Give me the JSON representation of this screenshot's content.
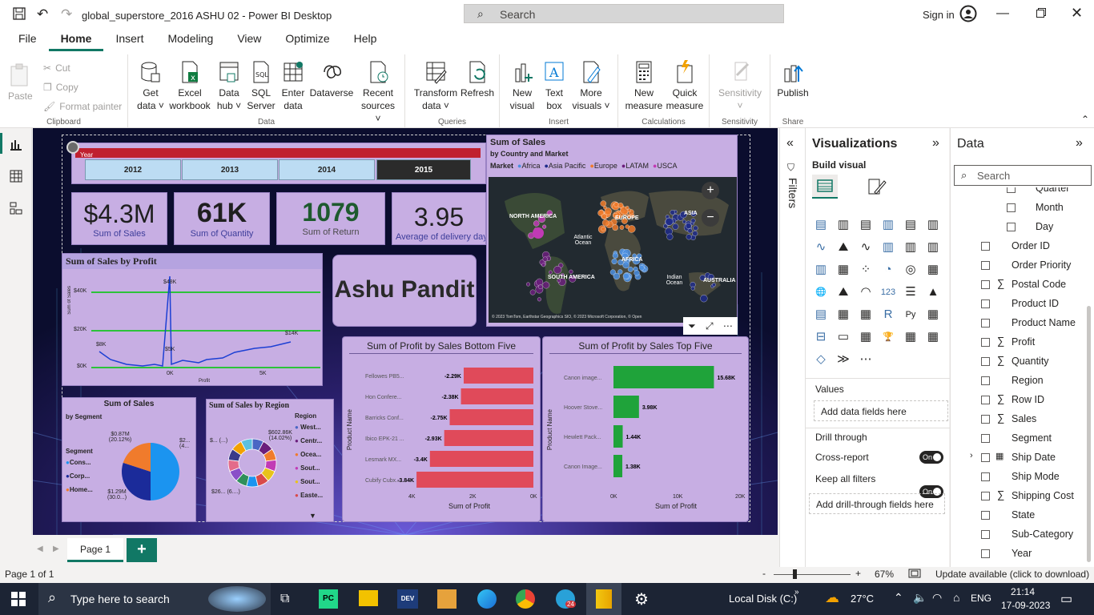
{
  "titlebar": {
    "file": "global_superstore_2016 ASHU 02 - Power BI Desktop",
    "search_placeholder": "Search",
    "signin": "Sign in"
  },
  "ribbon_tabs": [
    "File",
    "Home",
    "Insert",
    "Modeling",
    "View",
    "Optimize",
    "Help"
  ],
  "ribbon": {
    "clipboard": {
      "paste": "Paste",
      "cut": "Cut",
      "copy": "Copy",
      "format_painter": "Format painter",
      "label": "Clipboard"
    },
    "data": {
      "label": "Data",
      "get_data": [
        "Get",
        "data"
      ],
      "excel": [
        "Excel",
        "workbook"
      ],
      "data_hub": [
        "Data",
        "hub"
      ],
      "sql": [
        "SQL",
        "Server"
      ],
      "enter": [
        "Enter",
        "data"
      ],
      "dataverse": "Dataverse",
      "recent": [
        "Recent",
        "sources"
      ]
    },
    "queries": {
      "label": "Queries",
      "transform": [
        "Transform",
        "data"
      ],
      "refresh": "Refresh"
    },
    "insert": {
      "label": "Insert",
      "new_visual": [
        "New",
        "visual"
      ],
      "text_box": [
        "Text",
        "box"
      ],
      "more_visuals": [
        "More",
        "visuals"
      ]
    },
    "calculations": {
      "label": "Calculations",
      "new_measure": [
        "New",
        "measure"
      ],
      "quick_measure": [
        "Quick",
        "measure"
      ]
    },
    "sensitivity": {
      "label": "Sensitivity",
      "btn": "Sensitivity"
    },
    "share": {
      "label": "Share",
      "publish": "Publish"
    }
  },
  "report": {
    "year_label": "Year",
    "years": [
      "2012",
      "2013",
      "2014",
      "2015"
    ],
    "selected_year": "2015",
    "kpis": [
      {
        "value": "$4.3M",
        "label": "Sum of Sales"
      },
      {
        "value": "61K",
        "label": "Sum of Quantity"
      },
      {
        "value": "1079",
        "label": "Sum of Return"
      },
      {
        "value": "3.95",
        "label": "Average of delivery day"
      }
    ],
    "name_card": "Ashu Pandit",
    "map": {
      "title": "Sum of Sales",
      "subtitle": "by Country and Market",
      "legend_title": "Market",
      "legend": [
        {
          "name": "Africa",
          "color": "#4c8fe0"
        },
        {
          "name": "Asia Pacific",
          "color": "#1f2b8a"
        },
        {
          "name": "Europe",
          "color": "#f07b2c"
        },
        {
          "name": "LATAM",
          "color": "#6b1f7c"
        },
        {
          "name": "USCA",
          "color": "#c13ab5"
        }
      ],
      "regions": [
        "NORTH AMERICA",
        "EUROPE",
        "ASIA",
        "Atlantic Ocean",
        "AFRICA",
        "SOUTH AMERICA",
        "Indian Ocean",
        "AUSTRALIA"
      ],
      "copyright": "© 2023 TomTom, Earthstar Geographics SIO, © 2023 Microsoft Corporation, © Open"
    },
    "line": {
      "title": "Sum of Sales by Profit",
      "ylabel": "Sum of Sales",
      "xlabel": "Profit",
      "yticks": [
        "$40K",
        "$20K",
        "$0K"
      ],
      "xticks": [
        "0K",
        "5K"
      ],
      "labels": [
        "$8K",
        "$48K",
        "$5K",
        "$14K"
      ]
    },
    "pie": {
      "title": "Sum of Sales",
      "subtitle": "by Segment",
      "legend_title": "Segment",
      "legend": [
        "Cons...",
        "Corp...",
        "Home..."
      ],
      "labels": [
        "$0.87M (20.12%)",
        "$1.29M (30.0...)",
        "$2... (4..."
      ]
    },
    "donut": {
      "title": "Sum of Sales by Region",
      "legend_title": "Region",
      "legend": [
        {
          "name": "West...",
          "color": "#4a66c4"
        },
        {
          "name": "Centr...",
          "color": "#6b1f7c"
        },
        {
          "name": "Ocea...",
          "color": "#f07b2c"
        },
        {
          "name": "Sout...",
          "color": "#c13ab5"
        },
        {
          "name": "Sout...",
          "color": "#e8c31a"
        },
        {
          "name": "Easte...",
          "color": "#d94a4a"
        }
      ],
      "labels": [
        "$602.86K (14.02%)",
        "$... (...)",
        "$26... (6....)"
      ]
    },
    "bottom5": {
      "title": "Sum of Profit by Sales Bottom Five",
      "ylabel": "Product Name",
      "xlabel": "Sum of Profit",
      "xticks": [
        "4K",
        "2K",
        "0K"
      ]
    },
    "top5": {
      "title": "Sum of Profit by Sales Top Five",
      "ylabel": "Product Name",
      "xlabel": "Sum of Profit",
      "xticks": [
        "0K",
        "10K",
        "20K"
      ]
    }
  },
  "chart_data": [
    {
      "type": "bar",
      "title": "Sum of Profit by Sales Bottom Five",
      "categories": [
        "Fellowes PB5...",
        "Hon Confere...",
        "Barricks Conf...",
        "Ibico EPK-21 ...",
        "Lesmark MX...",
        "Cubify Cubx..."
      ],
      "values": [
        -2.29,
        -2.38,
        -2.75,
        -2.93,
        -3.4,
        -3.84
      ],
      "value_labels": [
        "-2.29K",
        "-2.38K",
        "-2.75K",
        "-2.93K",
        "-3.4K",
        "-3.84K"
      ],
      "unit": "K"
    },
    {
      "type": "bar",
      "title": "Sum of Profit by Sales Top Five",
      "categories": [
        "Canon imagе...",
        "Hoover Stove...",
        "Hewlett Pack...",
        "Canon Image..."
      ],
      "values": [
        15.68,
        3.98,
        1.44,
        1.38
      ],
      "value_labels": [
        "15.68K",
        "3.98K",
        "1.44K",
        "1.38K"
      ],
      "xlim": [
        0,
        20
      ],
      "unit": "K"
    },
    {
      "type": "pie",
      "title": "Sum of Sales",
      "series": [
        {
          "name": "Segment",
          "values": [
            50,
            30,
            20
          ]
        }
      ],
      "categories": [
        "Cons...",
        "Corp...",
        "Home..."
      ]
    }
  ],
  "filters": {
    "label": "Filters"
  },
  "viz": {
    "title": "Visualizations",
    "build": "Build visual",
    "values": "Values",
    "add_data": "Add data fields here",
    "drill": "Drill through",
    "cross": "Cross-report",
    "keep": "Keep all filters",
    "on": "On",
    "add_drill": "Add drill-through fields here"
  },
  "data": {
    "title": "Data",
    "search": "Search",
    "fields": [
      {
        "name": "Quarter",
        "sigma": false,
        "indent": true
      },
      {
        "name": "Month",
        "sigma": false,
        "indent": true
      },
      {
        "name": "Day",
        "sigma": false,
        "indent": true
      },
      {
        "name": "Order ID",
        "sigma": false
      },
      {
        "name": "Order Priority",
        "sigma": false
      },
      {
        "name": "Postal Code",
        "sigma": true
      },
      {
        "name": "Product ID",
        "sigma": false
      },
      {
        "name": "Product Name",
        "sigma": false
      },
      {
        "name": "Profit",
        "sigma": true
      },
      {
        "name": "Quantity",
        "sigma": true
      },
      {
        "name": "Region",
        "sigma": false
      },
      {
        "name": "Row ID",
        "sigma": true
      },
      {
        "name": "Sales",
        "sigma": true
      },
      {
        "name": "Segment",
        "sigma": false
      },
      {
        "name": "Ship Date",
        "sigma": false,
        "calendar": true
      },
      {
        "name": "Ship Mode",
        "sigma": false
      },
      {
        "name": "Shipping Cost",
        "sigma": true
      },
      {
        "name": "State",
        "sigma": false
      },
      {
        "name": "Sub-Category",
        "sigma": false
      },
      {
        "name": "Year",
        "sigma": false
      }
    ]
  },
  "pages": {
    "page1": "Page 1",
    "add": "+"
  },
  "status": {
    "page": "Page 1 of 1",
    "zoom": "67%",
    "update": "Update available (click to download)"
  },
  "taskbar": {
    "search": "Type here to search",
    "disk": "Local Disk (C:)",
    "temp": "27°C",
    "lang": "ENG",
    "time": "21:14",
    "date": "17-09-2023",
    "badge": "24"
  }
}
